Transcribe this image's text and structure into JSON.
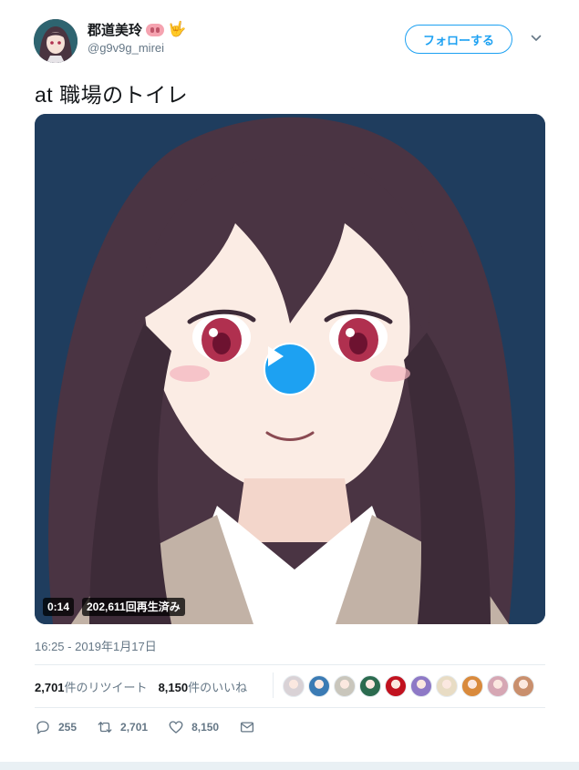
{
  "user": {
    "display_name": "郡道美玲",
    "handle": "@g9v9g_mirei",
    "follow_label": "フォローする"
  },
  "tweet": {
    "text": "at  職場のトイレ",
    "timestamp": "16:25 - 2019年1月17日"
  },
  "video": {
    "duration": "0:14",
    "views": "202,611回再生済み"
  },
  "stats": {
    "retweets_count": "2,701",
    "retweets_label": "件のリツイート",
    "likes_count": "8,150",
    "likes_label": "件のいいね"
  },
  "likers": [
    {
      "color": "#d9d2d6"
    },
    {
      "color": "#3b7bb4"
    },
    {
      "color": "#c9c6bc"
    },
    {
      "color": "#2b6b4f"
    },
    {
      "color": "#c1121f"
    },
    {
      "color": "#8e79c6"
    },
    {
      "color": "#e8dcc4"
    },
    {
      "color": "#d98a3c"
    },
    {
      "color": "#d6a7b4"
    },
    {
      "color": "#c98f6d"
    }
  ],
  "actions": {
    "reply_count": "255",
    "retweet_count": "2,701",
    "like_count": "8,150"
  },
  "colors": {
    "accent": "#1da1f2",
    "muted": "#657786",
    "text": "#14171a"
  }
}
